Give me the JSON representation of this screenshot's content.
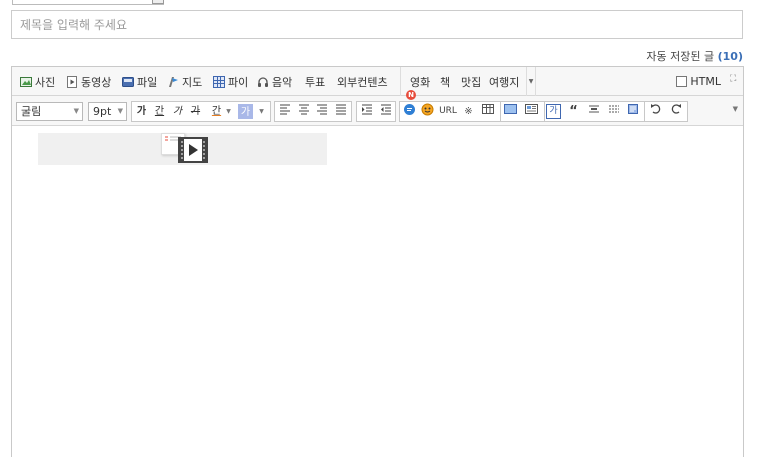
{
  "title_input": {
    "placeholder": "제목을 입력해 주세요",
    "value": ""
  },
  "autosave": {
    "label": "자동 저장된 글",
    "count": "(10)"
  },
  "toolbar1": {
    "items": [
      "사진",
      "동영상",
      "파일",
      "지도",
      "파이",
      "음악",
      "투표",
      "외부컨텐츠",
      "영화",
      "책",
      "맛집",
      "여행지"
    ],
    "html_label": "HTML"
  },
  "toolbar2": {
    "font": "굴림",
    "size": "9pt",
    "buttons": {
      "bold": "가",
      "underline": "간",
      "italic": "가",
      "strike": "가",
      "color": "간",
      "bg": "가"
    },
    "url_label": "URL",
    "badge": "N",
    "char_label": "※",
    "block_label": "가"
  },
  "colors": {
    "accent": "#3b6fb6",
    "badge": "#e74c3c",
    "toolbar_bg": "#f7f7f7"
  }
}
